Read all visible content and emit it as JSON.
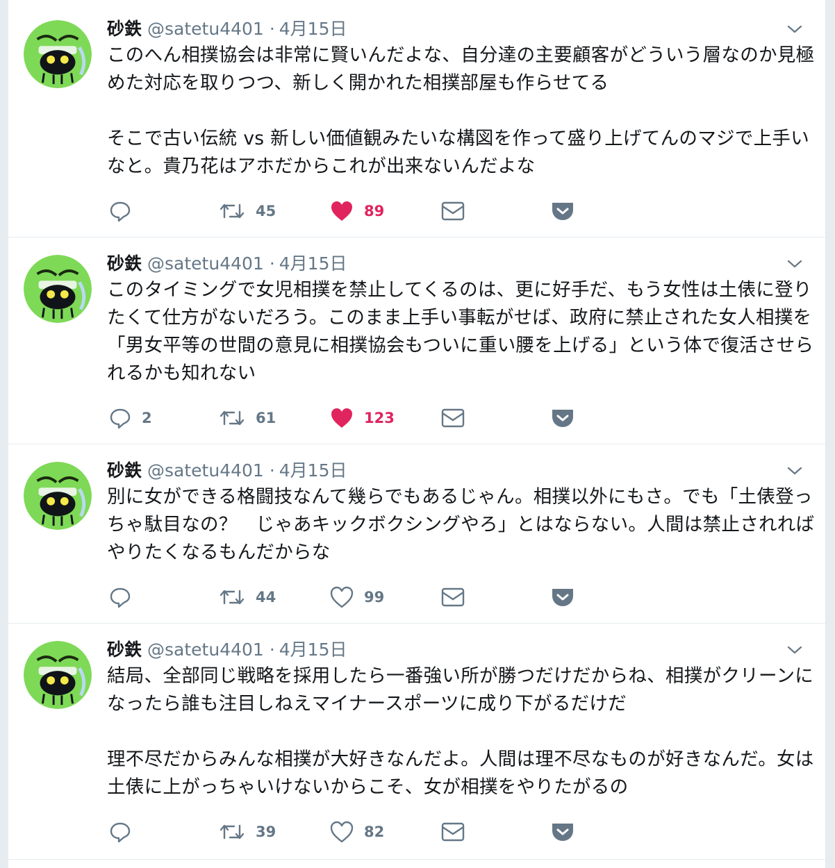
{
  "tweets": [
    {
      "name": "砂鉄",
      "handle": "@satetu4401",
      "sep": "·",
      "date": "4月15日",
      "text": "このへん相撲協会は非常に賢いんだよな、自分達の主要顧客がどういう層なのか見極めた対応を取りつつ、新しく開かれた相撲部屋も作らせてる\n\nそこで古い伝統 vs 新しい価値観みたいな構図を作って盛り上げてんのマジで上手いなと。貴乃花はアホだからこれが出来ないんだよな",
      "replies": "",
      "retweets": "45",
      "likes": "89",
      "liked": true
    },
    {
      "name": "砂鉄",
      "handle": "@satetu4401",
      "sep": "·",
      "date": "4月15日",
      "text": "このタイミングで女児相撲を禁止してくるのは、更に好手だ、もう女性は土俵に登りたくて仕方がないだろう。このまま上手い事転がせば、政府に禁止された女人相撲を「男女平等の世間の意見に相撲協会もついに重い腰を上げる」という体で復活させられるかも知れない",
      "replies": "2",
      "retweets": "61",
      "likes": "123",
      "liked": true
    },
    {
      "name": "砂鉄",
      "handle": "@satetu4401",
      "sep": "·",
      "date": "4月15日",
      "text": "別に女ができる格闘技なんて幾らでもあるじゃん。相撲以外にもさ。でも「土俵登っちゃ駄目なの？　じゃあキックボクシングやろ」とはならない。人間は禁止されればやりたくなるもんだからな",
      "replies": "",
      "retweets": "44",
      "likes": "99",
      "liked": false
    },
    {
      "name": "砂鉄",
      "handle": "@satetu4401",
      "sep": "·",
      "date": "4月15日",
      "text": "結局、全部同じ戦略を採用したら一番強い所が勝つだけだからね、相撲がクリーンになったら誰も注目しねえマイナースポーツに成り下がるだけだ\n\n理不尽だからみんな相撲が大好きなんだよ。人間は理不尽なものが好きなんだ。女は土俵に上がっちゃいけないからこそ、女が相撲をやりたがるの",
      "replies": "",
      "retweets": "39",
      "likes": "82",
      "liked": false
    }
  ],
  "colors": {
    "page_bg": "#e6ecf0",
    "card_bg": "#ffffff",
    "text": "#14171a",
    "secondary": "#657786",
    "like": "#e0245e",
    "avatar_green": "#7ed957"
  },
  "icons": {
    "reply": "reply-icon",
    "retweet": "retweet-icon",
    "like": "heart-icon",
    "dm": "envelope-icon",
    "save": "pocket-icon",
    "menu": "chevron-down-icon"
  }
}
